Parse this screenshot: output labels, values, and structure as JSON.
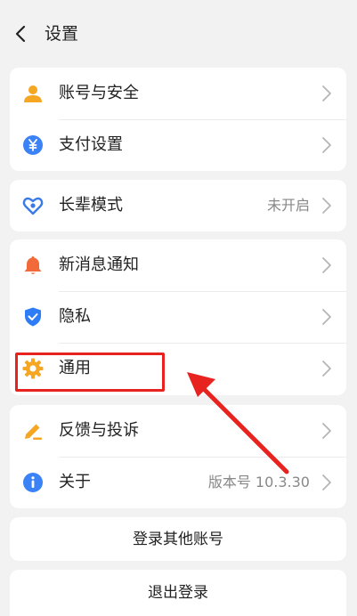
{
  "header": {
    "title": "设置",
    "back_icon": "chevron-left-icon"
  },
  "groups": {
    "account": {
      "items": [
        {
          "label": "账号与安全",
          "icon": "user-icon",
          "icon_color": "#f5a623"
        },
        {
          "label": "支付设置",
          "icon": "yuan-icon",
          "icon_color": "#3b82f6"
        }
      ]
    },
    "elder": {
      "items": [
        {
          "label": "长辈模式",
          "value": "未开启",
          "icon": "heart-icon",
          "icon_color": "#3b7be8"
        }
      ]
    },
    "general": {
      "items": [
        {
          "label": "新消息通知",
          "icon": "bell-icon",
          "icon_color": "#f26a3a"
        },
        {
          "label": "隐私",
          "icon": "shield-icon",
          "icon_color": "#2f7df6"
        },
        {
          "label": "通用",
          "icon": "gear-icon",
          "icon_color": "#f5a623"
        }
      ]
    },
    "support": {
      "items": [
        {
          "label": "反馈与投诉",
          "icon": "edit-icon",
          "icon_color": "#f5a623"
        },
        {
          "label": "关于",
          "value": "版本号 10.3.30",
          "icon": "info-icon",
          "icon_color": "#3b82f6"
        }
      ]
    }
  },
  "buttons": {
    "login_other": "登录其他账号",
    "logout": "退出登录"
  },
  "annotation": {
    "color": "#e8231f"
  }
}
